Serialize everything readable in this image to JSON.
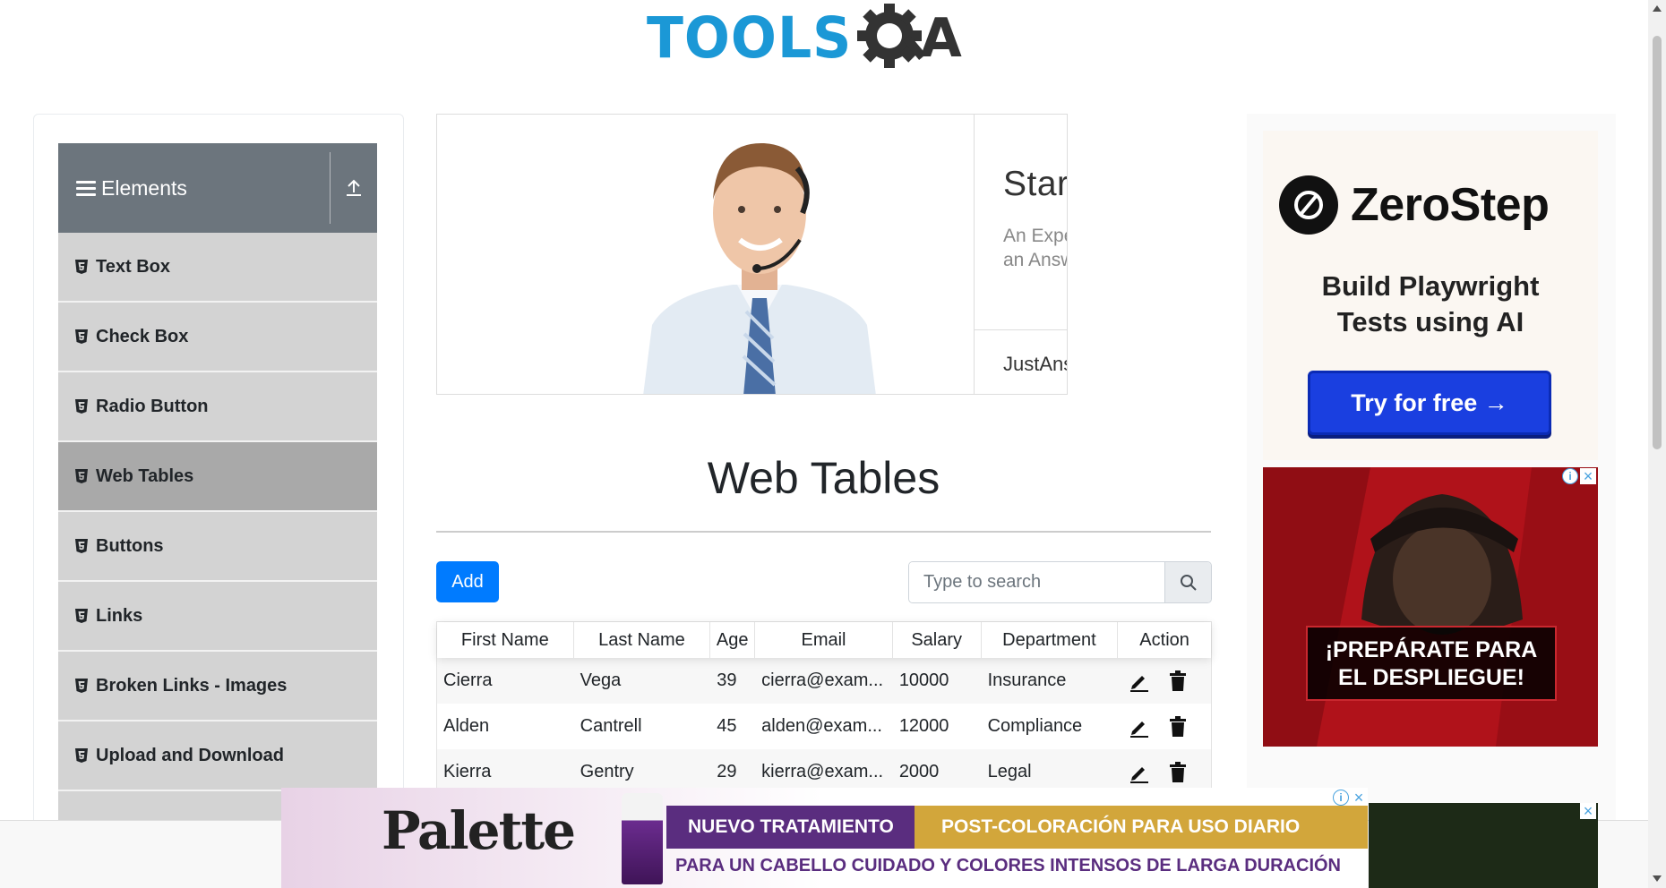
{
  "logo": {
    "text_left": "TOOLS",
    "text_right": "A"
  },
  "sidebar": {
    "group_title": "Elements",
    "items": [
      {
        "label": "Text Box",
        "active": false
      },
      {
        "label": "Check Box",
        "active": false
      },
      {
        "label": "Radio Button",
        "active": false
      },
      {
        "label": "Web Tables",
        "active": true
      },
      {
        "label": "Buttons",
        "active": false
      },
      {
        "label": "Links",
        "active": false
      },
      {
        "label": "Broken Links - Images",
        "active": false
      },
      {
        "label": "Upload and Download",
        "active": false
      }
    ]
  },
  "ad_chat": {
    "headline": "Start Chatting",
    "sub_line1": "An Expert Will Answer in Mi",
    "sub_line2": "an Answer ASAP.",
    "brand": "JustAnswer"
  },
  "ad_zerostep": {
    "name": "ZeroStep",
    "tag_line1": "Build Playwright",
    "tag_line2": "Tests using AI",
    "cta": "Try for free →"
  },
  "ad_game": {
    "text_line1": "¡PREPÁRATE PARA",
    "text_line2": "EL DESPLIEGUE!"
  },
  "ad_palette": {
    "logo": "Palette",
    "band1": "NUEVO TRATAMIENTO",
    "band2": "POST-COLORACIÓN PARA USO DIARIO",
    "line2": "PARA UN CABELLO CUIDADO Y COLORES INTENSOS DE LARGA DURACIÓN"
  },
  "main": {
    "title": "Web Tables",
    "add_label": "Add",
    "search_placeholder": "Type to search"
  },
  "table": {
    "headers": [
      "First Name",
      "Last Name",
      "Age",
      "Email",
      "Salary",
      "Department",
      "Action"
    ],
    "rows": [
      [
        "Cierra",
        "Vega",
        "39",
        "cierra@exam...",
        "10000",
        "Insurance"
      ],
      [
        "Alden",
        "Cantrell",
        "45",
        "alden@exam...",
        "12000",
        "Compliance"
      ],
      [
        "Kierra",
        "Gentry",
        "29",
        "kierra@exam...",
        "2000",
        "Legal"
      ]
    ]
  },
  "colors": {
    "accent": "#007bff",
    "sidebar_header": "#6c757d",
    "menu_item": "#d3d3d3",
    "menu_active": "#a9a9a9",
    "logo_blue": "#1b98d6"
  },
  "icons": [
    "upload-icon",
    "hamburger-icon",
    "html5-icon",
    "search-icon",
    "edit-icon",
    "trash-icon",
    "adchoices-icon",
    "close-icon"
  ]
}
